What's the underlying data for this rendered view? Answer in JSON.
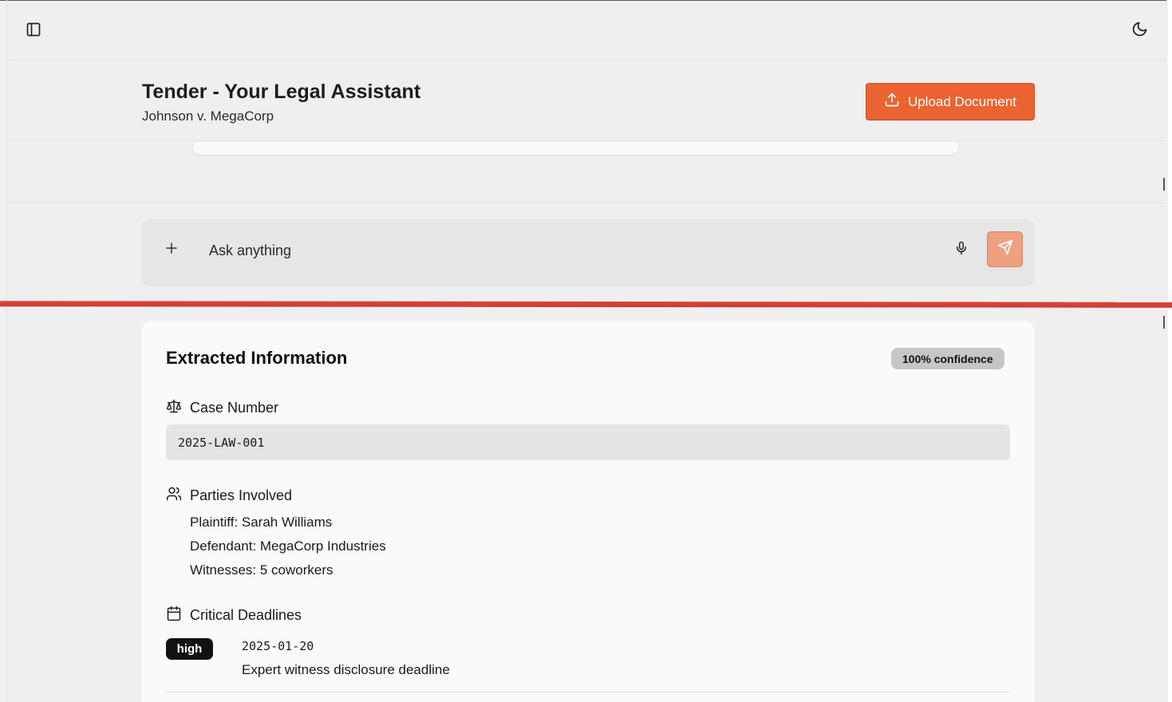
{
  "header": {
    "title": "Tender - Your Legal Assistant",
    "subtitle": "Johnson v. MegaCorp",
    "upload_label": "Upload Document"
  },
  "icons": {
    "sidebar_toggle": "sidebar-toggle-icon",
    "theme_toggle": "moon-icon",
    "upload": "upload-icon",
    "plus": "plus-icon",
    "mic": "microphone-icon",
    "send": "send-icon",
    "case_number": "scale-icon",
    "parties": "users-icon",
    "deadlines": "calendar-icon"
  },
  "chat": {
    "placeholder": "Ask anything"
  },
  "extracted": {
    "title": "Extracted Information",
    "confidence": "100% confidence",
    "case_number_label": "Case Number",
    "case_number_value": "2025-LAW-001",
    "parties_label": "Parties Involved",
    "parties": [
      "Plaintiff: Sarah Williams",
      "Defendant: MegaCorp Industries",
      "Witnesses: 5 coworkers"
    ],
    "deadlines_label": "Critical Deadlines",
    "deadlines": [
      {
        "priority": "high",
        "date": "2025-01-20",
        "description": "Expert witness disclosure deadline"
      }
    ]
  },
  "colors": {
    "accent": "#ea6330",
    "send_button": "#eea07f",
    "annotation_line": "#d9463d",
    "background": "#efefef",
    "card": "#fafafa"
  }
}
